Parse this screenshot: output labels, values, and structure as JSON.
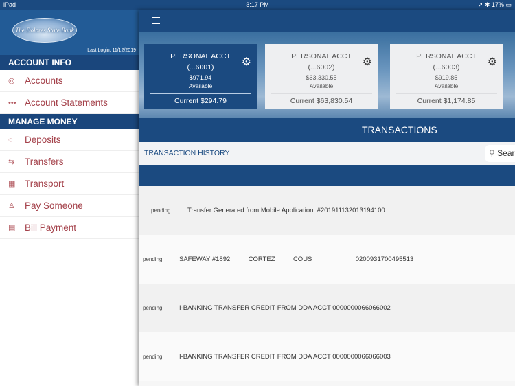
{
  "status": {
    "device": "iPad",
    "time": "3:17 PM",
    "battery": "17%"
  },
  "sidebar": {
    "bank_name": "The Dolores State Bank",
    "last_login": "Last Login:  11/12/2019",
    "sections": [
      {
        "title": "ACCOUNT INFO",
        "items": [
          {
            "label": "Accounts",
            "icon": "coins-icon"
          },
          {
            "label": "Account Statements",
            "icon": "ellipsis-icon"
          }
        ]
      },
      {
        "title": "MANAGE MONEY",
        "items": [
          {
            "label": "Deposits",
            "icon": "piggy-bank-icon"
          },
          {
            "label": "Transfers",
            "icon": "transfer-icon"
          },
          {
            "label": "Transport",
            "icon": "transport-icon"
          },
          {
            "label": "Pay Someone",
            "icon": "person-pay-icon"
          },
          {
            "label": "Bill Payment",
            "icon": "bill-icon"
          }
        ]
      }
    ]
  },
  "accounts": [
    {
      "name": "PERSONAL ACCT",
      "number": "(...6001)",
      "available_amount": "$971.94",
      "available_label": "Available",
      "current": "Current $294.79",
      "selected": true
    },
    {
      "name": "PERSONAL ACCT",
      "number": "(...6002)",
      "available_amount": "$63,330.55",
      "available_label": "Available",
      "current": "Current $63,830.54"
    },
    {
      "name": "PERSONAL ACCT",
      "number": "(...6003)",
      "available_amount": "$919.85",
      "available_label": "Available",
      "current": "Current $1,174.85"
    }
  ],
  "transactions": {
    "title": "TRANSACTIONS",
    "history_label": "TRANSACTION HISTORY",
    "search_placeholder": "Sear",
    "rows": [
      {
        "status": "pending",
        "description": "Transfer Generated from Mobile Application. #201911132013194100"
      },
      {
        "status": "pending",
        "description": "SAFEWAY #1892          CORTEZ          COUS                        0200931700495513"
      },
      {
        "status": "pending",
        "description": "I-BANKING TRANSFER CREDIT FROM DDA ACCT 0000000066066002"
      },
      {
        "status": "pending",
        "description": "I-BANKING TRANSFER CREDIT FROM DDA ACCT 0000000066066003"
      }
    ]
  },
  "colors": {
    "primary": "#1b4a80",
    "accent": "#a4414a"
  }
}
